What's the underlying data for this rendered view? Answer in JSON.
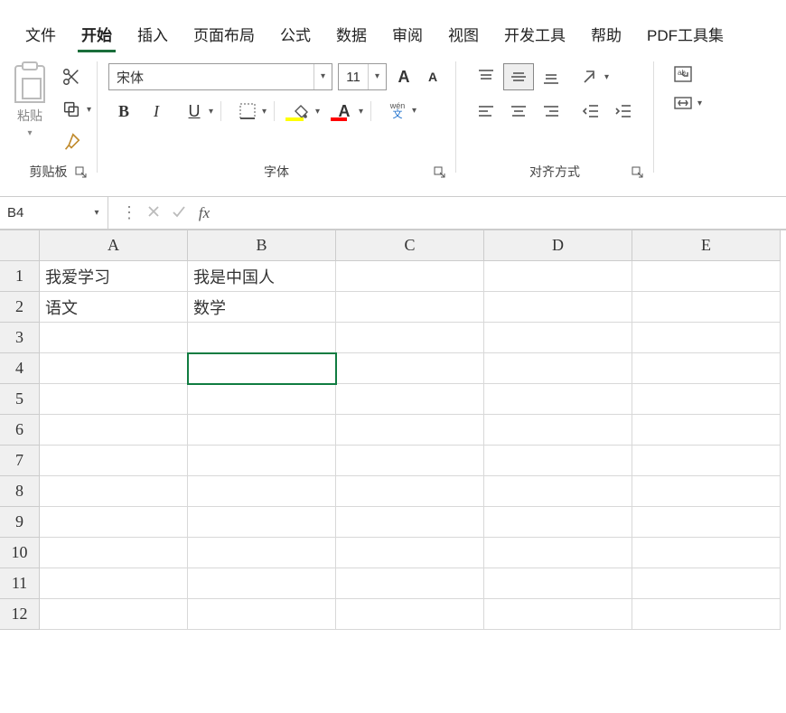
{
  "menubar": {
    "tabs": [
      {
        "label": "文件"
      },
      {
        "label": "开始",
        "active": true
      },
      {
        "label": "插入"
      },
      {
        "label": "页面布局"
      },
      {
        "label": "公式"
      },
      {
        "label": "数据"
      },
      {
        "label": "审阅"
      },
      {
        "label": "视图"
      },
      {
        "label": "开发工具"
      },
      {
        "label": "帮助"
      },
      {
        "label": "PDF工具集"
      }
    ]
  },
  "ribbon": {
    "clipboard": {
      "paste_label": "粘贴",
      "group_label": "剪贴板"
    },
    "font": {
      "font_name": "宋体",
      "font_size": "11",
      "group_label": "字体",
      "bold": "B",
      "italic": "I",
      "underline": "U",
      "increase_A": "A",
      "decrease_A": "A",
      "fontcolor_A": "A",
      "phonetic_top": "wén",
      "phonetic_bot": "文"
    },
    "alignment": {
      "group_label": "对齐方式",
      "wrap_label": "ab"
    }
  },
  "name_box": {
    "ref": "B4",
    "fx": "fx"
  },
  "grid": {
    "cols": [
      "A",
      "B",
      "C",
      "D",
      "E"
    ],
    "rows": [
      "1",
      "2",
      "3",
      "4",
      "5",
      "6",
      "7",
      "8",
      "9",
      "10",
      "11",
      "12"
    ],
    "selected": {
      "row": 4,
      "col": "B"
    },
    "cells": {
      "A1": "我爱学习",
      "B1": "我是中国人",
      "A2": "语文",
      "B2": "数学"
    }
  }
}
